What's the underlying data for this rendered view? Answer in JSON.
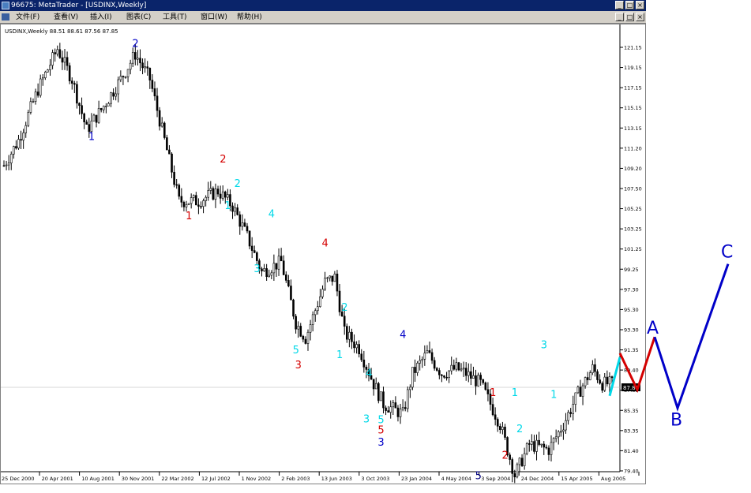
{
  "window": {
    "title": "96675: MetaTrader - [USDINX,Weekly]",
    "min_label": "_",
    "max_label": "□",
    "close_label": "×"
  },
  "menu": {
    "items": [
      "文件(F)",
      "查看(V)",
      "插入(I)",
      "图表(C)",
      "工具(T)",
      "窗口(W)",
      "帮助(H)"
    ]
  },
  "chart": {
    "header_text": "USDINX,Weekly 88.51 88.61 87.56 87.85",
    "current_price_label": "87.85",
    "colors": {
      "candle": "#000000",
      "red": "#d40000",
      "cyan": "#00d8e8",
      "blue": "#0000c8",
      "navy": "#000080"
    }
  },
  "chart_data": {
    "type": "candlestick",
    "y_ticks": [
      "121.15",
      "119.15",
      "117.15",
      "115.15",
      "113.15",
      "111.20",
      "109.20",
      "107.50",
      "105.25",
      "103.25",
      "101.25",
      "99.25",
      "97.30",
      "95.30",
      "93.30",
      "91.35",
      "89.40",
      "87.35",
      "85.35",
      "83.35",
      "81.40",
      "79.40"
    ],
    "x_ticks": [
      "25 Dec 2000",
      "20 Apr 2001",
      "10 Aug 2001",
      "30 Nov 2001",
      "22 Mar 2002",
      "12 Jul 2002",
      "1 Nov 2002",
      "2 Feb 2003",
      "13 Jun 2003",
      "3 Oct 2003",
      "23 Jan 2004",
      "4 May 2004",
      "3 Sep 2004",
      "24 Dec 2004",
      "15 Apr 2005",
      "Aug 2005"
    ],
    "waypoints": [
      [
        0,
        109.5
      ],
      [
        6,
        112
      ],
      [
        14,
        117
      ],
      [
        22,
        121
      ],
      [
        28,
        118
      ],
      [
        34,
        113
      ],
      [
        40,
        115
      ],
      [
        48,
        118
      ],
      [
        54,
        120.5
      ],
      [
        60,
        118
      ],
      [
        66,
        112
      ],
      [
        72,
        106
      ],
      [
        80,
        106
      ],
      [
        88,
        107
      ],
      [
        94,
        105.5
      ],
      [
        100,
        102.5
      ],
      [
        106,
        99
      ],
      [
        114,
        100
      ],
      [
        120,
        94
      ],
      [
        124,
        92.5
      ],
      [
        132,
        98
      ],
      [
        136,
        98.5
      ],
      [
        140,
        93
      ],
      [
        146,
        91.5
      ],
      [
        152,
        88
      ],
      [
        156,
        86
      ],
      [
        164,
        85
      ],
      [
        168,
        89
      ],
      [
        174,
        91
      ],
      [
        180,
        89
      ],
      [
        186,
        89.5
      ],
      [
        190,
        89
      ],
      [
        196,
        88
      ],
      [
        204,
        84
      ],
      [
        210,
        79
      ],
      [
        216,
        82
      ],
      [
        224,
        81.5
      ],
      [
        230,
        84
      ],
      [
        236,
        87
      ],
      [
        242,
        89.5
      ],
      [
        246,
        88
      ],
      [
        250,
        88
      ]
    ],
    "wave_labels": [
      {
        "text": "2",
        "color": "blue",
        "price": 121.2,
        "bar": 54
      },
      {
        "text": "1",
        "color": "blue",
        "price": 112,
        "bar": 36
      },
      {
        "text": "2",
        "color": "red",
        "price": 109.8,
        "bar": 90
      },
      {
        "text": "2",
        "color": "cyan",
        "price": 107.4,
        "bar": 96
      },
      {
        "text": "1",
        "color": "red",
        "price": 104.2,
        "bar": 76
      },
      {
        "text": "1",
        "color": "cyan",
        "price": 105.2,
        "bar": 92
      },
      {
        "text": "4",
        "color": "cyan",
        "price": 104.4,
        "bar": 110
      },
      {
        "text": "3",
        "color": "cyan",
        "price": 99,
        "bar": 104
      },
      {
        "text": "4",
        "color": "red",
        "price": 101.5,
        "bar": 132
      },
      {
        "text": "5",
        "color": "cyan",
        "price": 91,
        "bar": 120
      },
      {
        "text": "3",
        "color": "red",
        "price": 89.5,
        "bar": 121
      },
      {
        "text": "2",
        "color": "cyan",
        "price": 95.2,
        "bar": 140
      },
      {
        "text": "1",
        "color": "cyan",
        "price": 90.5,
        "bar": 138
      },
      {
        "text": "4",
        "color": "blue",
        "price": 92.5,
        "bar": 164
      },
      {
        "text": "4",
        "color": "cyan",
        "price": 88.7,
        "bar": 150
      },
      {
        "text": "3",
        "color": "cyan",
        "price": 84.2,
        "bar": 149
      },
      {
        "text": "5",
        "color": "cyan",
        "price": 84.1,
        "bar": 155
      },
      {
        "text": "5",
        "color": "red",
        "price": 83.1,
        "bar": 155
      },
      {
        "text": "3",
        "color": "blue",
        "price": 81.9,
        "bar": 155
      },
      {
        "text": "1",
        "color": "red",
        "price": 86.8,
        "bar": 201
      },
      {
        "text": "1",
        "color": "cyan",
        "price": 86.8,
        "bar": 210
      },
      {
        "text": "2",
        "color": "cyan",
        "price": 83.2,
        "bar": 212
      },
      {
        "text": "2",
        "color": "red",
        "price": 80.6,
        "bar": 206
      },
      {
        "text": "3",
        "color": "cyan",
        "price": 91.5,
        "bar": 222
      },
      {
        "text": "1",
        "color": "cyan",
        "price": 86.6,
        "bar": 226
      },
      {
        "text": "5",
        "color": "navy",
        "price": 78.6,
        "bar": 195
      }
    ],
    "projection": {
      "a_label": "A",
      "b_label": "B",
      "c_label": "C",
      "cyan_segment": [
        [
          86.8,
          90.6
        ]
      ],
      "red_path": [
        [
          91,
          87.4
        ],
        [
          92.6
        ]
      ],
      "blue_path": [
        [
          92.6,
          85.6,
          99.8
        ]
      ]
    }
  }
}
